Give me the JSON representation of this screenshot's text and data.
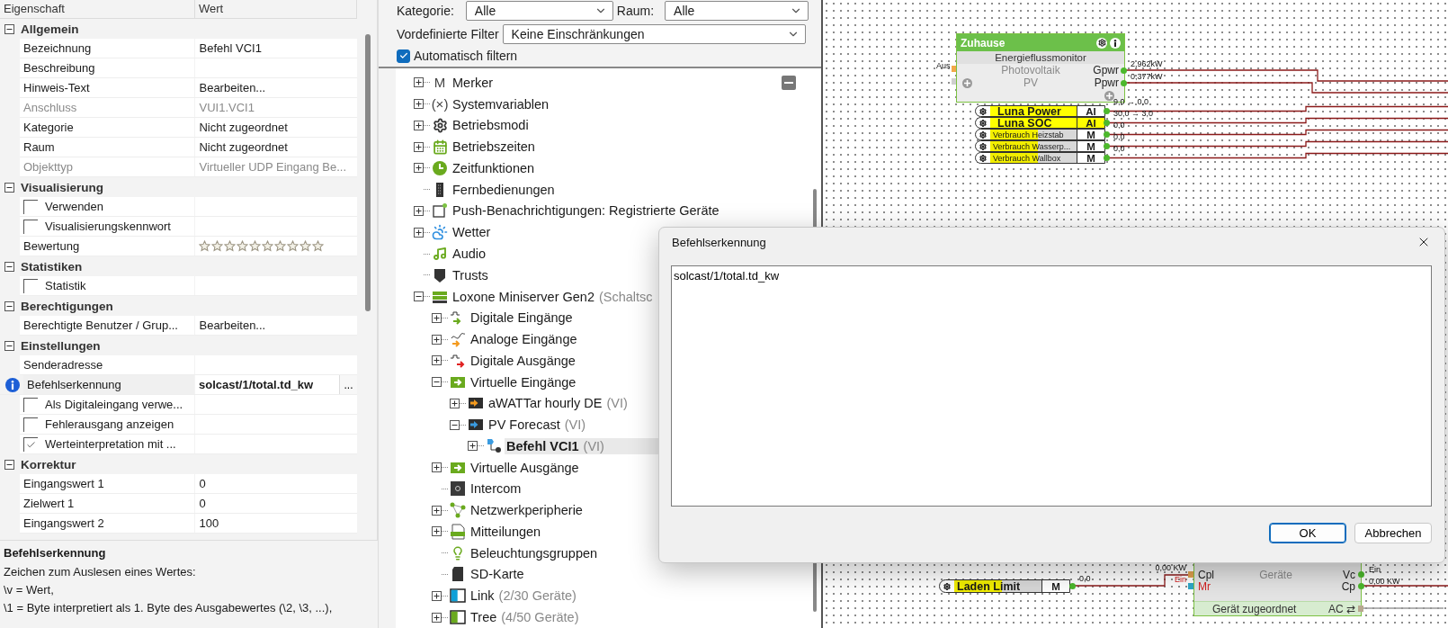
{
  "properties": {
    "columns": [
      "Eigenschaft",
      "Wert"
    ],
    "groups": [
      {
        "title": "Allgemein",
        "expanded": true,
        "rows": [
          {
            "kind": "text",
            "label": "Bezeichnung",
            "value": "Befehl VCI1",
            "disabled": false
          },
          {
            "kind": "text",
            "label": "Beschreibung",
            "disabled": false
          },
          {
            "kind": "text",
            "label": "Hinweis-Text",
            "value": "Bearbeiten...",
            "disabled": false
          },
          {
            "kind": "text",
            "label": "Anschluss",
            "value": "VUI1.VCI1",
            "disabled": true
          },
          {
            "kind": "text",
            "label": "Kategorie",
            "value": "Nicht zugeordnet",
            "disabled": false
          },
          {
            "kind": "text",
            "label": "Raum",
            "value": "Nicht zugeordnet",
            "disabled": false
          },
          {
            "kind": "text",
            "label": "Objekttyp",
            "value": "Virtueller UDP Eingang Be...",
            "disabled": true
          }
        ]
      },
      {
        "title": "Visualisierung",
        "expanded": true,
        "rows": [
          {
            "kind": "checkbox",
            "label": "Verwenden",
            "checked": false
          },
          {
            "kind": "checkbox",
            "label": "Visualisierungskennwort",
            "checked": false
          },
          {
            "kind": "stars",
            "label": "Bewertung",
            "stars": 0
          }
        ]
      },
      {
        "title": "Statistiken",
        "expanded": true,
        "rows": [
          {
            "kind": "checkbox",
            "label": "Statistik",
            "checked": false
          }
        ]
      },
      {
        "title": "Berechtigungen",
        "expanded": true,
        "rows": [
          {
            "kind": "text",
            "label": "Berechtigte Benutzer / Grup...",
            "value": "Bearbeiten...",
            "disabled": false
          }
        ]
      },
      {
        "title": "Einstellungen",
        "expanded": true,
        "rows": [
          {
            "kind": "text",
            "label": "Senderadresse",
            "disabled": false
          },
          {
            "kind": "info",
            "label": "Befehlserkennung",
            "value": "solcast/1/total.td_kw",
            "button": "..."
          },
          {
            "kind": "checkbox",
            "label": "Als Digitaleingang verwe...",
            "checked": false
          },
          {
            "kind": "checkbox",
            "label": "Fehlerausgang anzeigen",
            "checked": false
          },
          {
            "kind": "checkbox",
            "label": "Werteinterpretation mit ...",
            "checked": true
          }
        ]
      },
      {
        "title": "Korrektur",
        "expanded": true,
        "rows": [
          {
            "kind": "text",
            "label": "Eingangswert 1",
            "value": "0",
            "disabled": false
          },
          {
            "kind": "text",
            "label": "Zielwert 1",
            "value": "0",
            "disabled": false
          },
          {
            "kind": "text",
            "label": "Eingangswert 2",
            "value": "100",
            "disabled": false
          }
        ]
      }
    ]
  },
  "help": {
    "title": "Befehlserkennung",
    "lines": [
      "Zeichen zum Auslesen eines Wertes:",
      "\\v = Wert,",
      "\\1 = Byte interpretiert als 1. Byte des Ausgabewertes (\\2, \\3, ...),"
    ]
  },
  "filters": {
    "category_label": "Kategorie:",
    "category": "Alle",
    "room_label": "Raum:",
    "room": "Alle",
    "preset_label": "Vordefinierte Filter",
    "preset": "Keine Einschränkungen",
    "auto_label": "Automatisch filtern",
    "auto": true
  },
  "tree": [
    {
      "kind": "glyph",
      "glyph": "M",
      "label": "Merker",
      "expanded": false,
      "selected": false
    },
    {
      "kind": "glyph",
      "glyph": "(×)",
      "label": "Systemvariablen",
      "expanded": false,
      "selected": false
    },
    {
      "kind": "modes",
      "label": "Betriebsmodi",
      "expanded": false,
      "selected": false
    },
    {
      "kind": "schedule",
      "label": "Betriebszeiten",
      "expanded": false,
      "selected": false
    },
    {
      "kind": "timer",
      "label": "Zeitfunktionen",
      "expanded": false,
      "selected": false
    },
    {
      "kind": "remote",
      "label": "Fernbedienungen",
      "selected": false
    },
    {
      "kind": "push",
      "label": "Push-Benachrichtigungen: Registrierte Geräte",
      "expanded": false,
      "selected": false
    },
    {
      "kind": "weather",
      "label": "Wetter",
      "expanded": false,
      "selected": false
    },
    {
      "kind": "audio",
      "label": "Audio",
      "selected": false
    },
    {
      "kind": "trust",
      "label": "Trusts",
      "selected": false
    },
    {
      "kind": "miniserver",
      "label": "Loxone Miniserver Gen2",
      "note": "(Schaltsc",
      "expanded": true,
      "selected": false,
      "children": [
        {
          "kind": "digital-in",
          "label": "Digitale Eingänge",
          "expanded": false,
          "selected": false
        },
        {
          "kind": "analog-in",
          "label": "Analoge Eingänge",
          "expanded": false,
          "selected": false
        },
        {
          "kind": "digital-out",
          "label": "Digitale Ausgänge",
          "expanded": false,
          "selected": false
        },
        {
          "kind": "virtual",
          "label": "Virtuelle Eingänge",
          "expanded": true,
          "selected": false,
          "children": [
            {
              "kind": "virtual-device",
              "color": "#f39a1e",
              "label": "aWATTar hourly DE",
              "note": "(VI)",
              "expanded": false,
              "selected": false
            },
            {
              "kind": "virtual-device",
              "color": "#3a9be0",
              "label": "PV Forecast",
              "note": "(VI)",
              "expanded": true,
              "selected": false,
              "children": [
                {
                  "kind": "command",
                  "label": "Befehl VCI1",
                  "note": "(VI)",
                  "expanded": false,
                  "selected": true
                }
              ]
            }
          ]
        },
        {
          "kind": "virtual",
          "label": "Virtuelle Ausgänge",
          "expanded": false,
          "selected": false
        },
        {
          "kind": "intercom",
          "label": "Intercom",
          "selected": false
        },
        {
          "kind": "network",
          "label": "Netzwerkperipherie",
          "expanded": false,
          "selected": false
        },
        {
          "kind": "messages",
          "label": "Mitteilungen",
          "expanded": false,
          "selected": false
        },
        {
          "kind": "lighting",
          "label": "Beleuchtungsgruppen",
          "selected": false
        },
        {
          "kind": "sdcard",
          "label": "SD-Karte",
          "selected": false
        },
        {
          "kind": "link",
          "label": "Link",
          "note": "(2/30 Geräte)",
          "expanded": false,
          "selected": false
        },
        {
          "kind": "treeext",
          "label": "Tree",
          "note": "(4/50 Geräte)",
          "expanded": false,
          "selected": false
        }
      ]
    }
  ],
  "canvas": {
    "monitor": {
      "title": "Zuhause",
      "subtitle": "Energieflussmonitor",
      "input_label": "Aus",
      "inputs": [
        "Photovoltaik",
        "PV"
      ],
      "outputs": [
        {
          "name": "Gpwr",
          "reading": "2,962kW"
        },
        {
          "name": "Ppwr",
          "reading": "0,377kW"
        }
      ]
    },
    "inputs": [
      {
        "kind": "analog",
        "name": "Luna Power",
        "type": "AI",
        "type_highlighted": false,
        "reading": "9,0 → 0,0"
      },
      {
        "kind": "analog",
        "name": "Luna SOC",
        "type": "AI",
        "type_highlighted": true,
        "reading": "30,0 → 3,0"
      },
      {
        "kind": "memory",
        "name": "Verbrauch Heizstab",
        "type": "M",
        "type_highlighted": false,
        "reading": "0,0"
      },
      {
        "kind": "memory",
        "name": "Verbrauch Wasserp...",
        "type": "M",
        "type_highlighted": false,
        "reading": "0,0"
      },
      {
        "kind": "memory",
        "name": "Verbrauch Wallbox",
        "type": "M",
        "type_highlighted": false,
        "reading": "0,0"
      }
    ],
    "limit": {
      "kind": "memory",
      "name": "Laden Limit",
      "type": "M",
      "type_highlighted": false,
      "reading": "0,0"
    },
    "device": {
      "label": "Geräte",
      "inputs": [
        {
          "name": "Cpl",
          "reading": "0,00 KW",
          "alert": false
        },
        {
          "name": "Mr",
          "reading": "Ein",
          "alert": true
        }
      ],
      "outputs": [
        {
          "name": "Vc",
          "reading": "Ein"
        },
        {
          "name": "Cp",
          "reading": "0,00 KW"
        }
      ],
      "status": "Gerät zugeordnet",
      "status_output": "AC ⇄"
    }
  },
  "dialog": {
    "title": "Befehlserkennung",
    "value": "solcast/1/total.td_kw",
    "buttons": [
      {
        "label": "OK",
        "default": true
      },
      {
        "label": "Abbrechen",
        "default": false
      }
    ]
  }
}
